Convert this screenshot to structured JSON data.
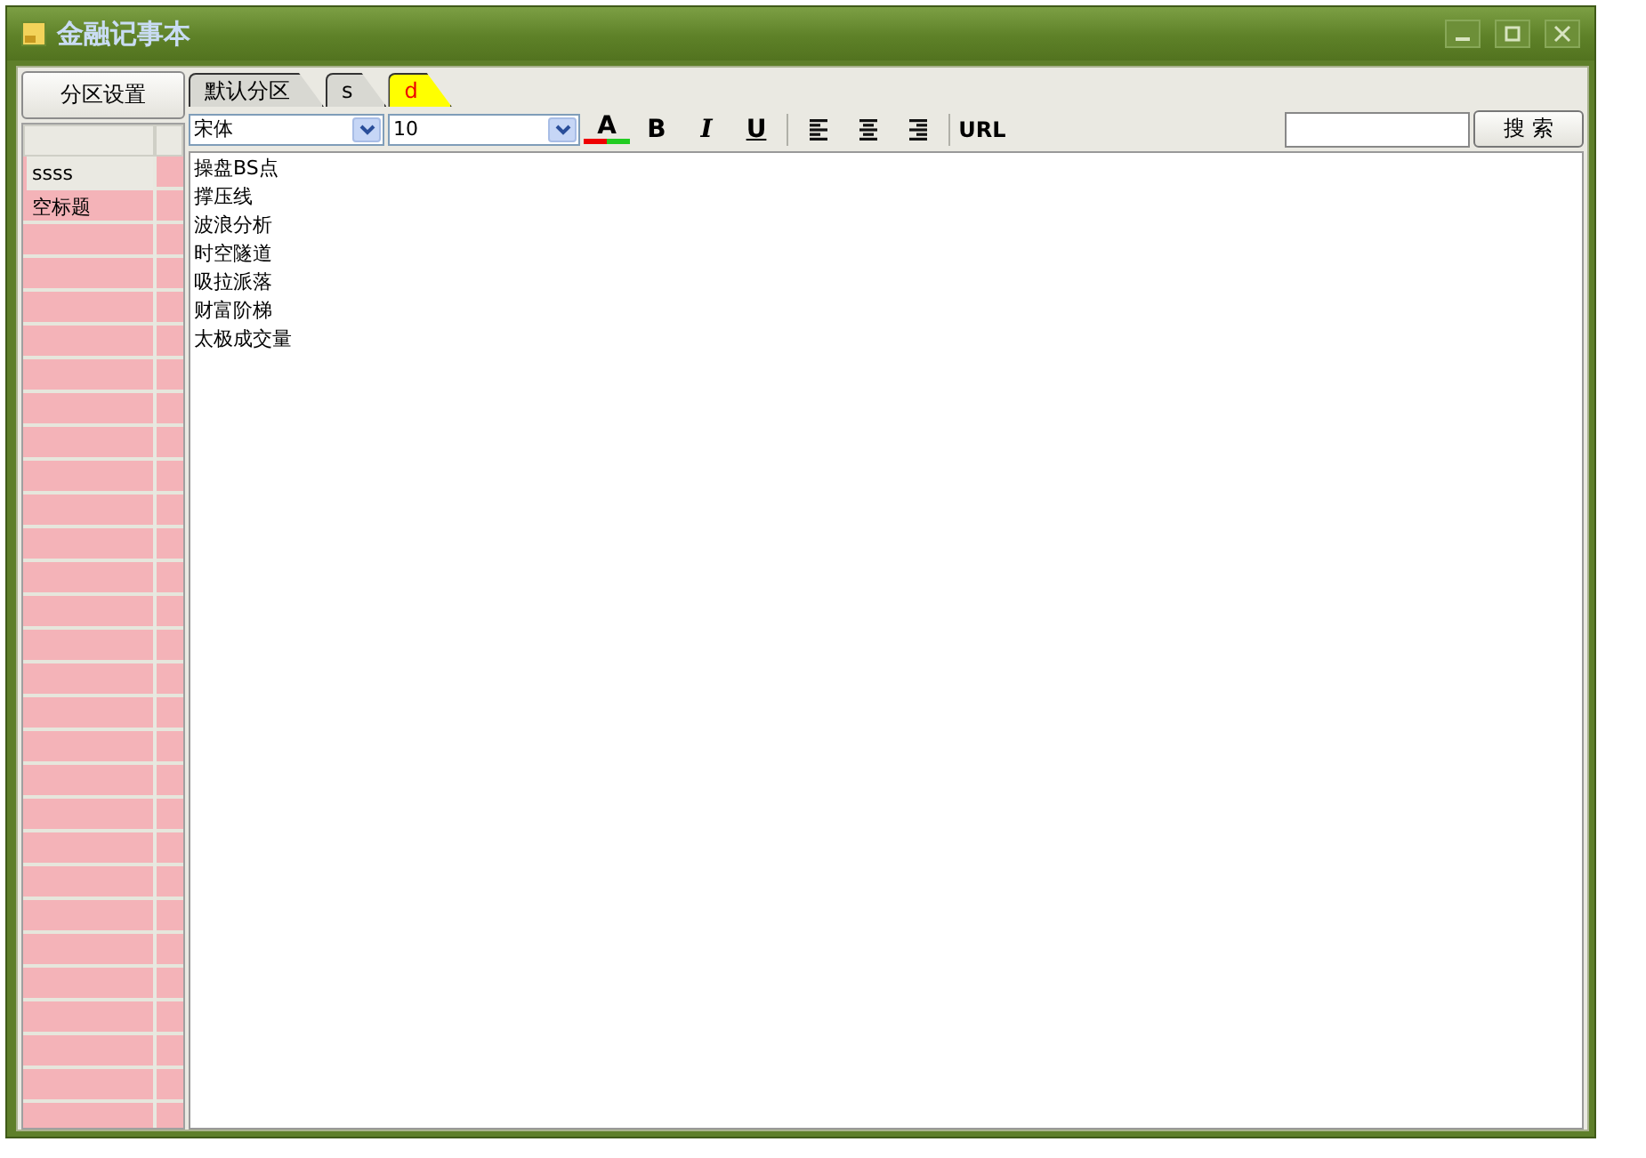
{
  "window": {
    "title": "金融记事本"
  },
  "sidebar": {
    "settings_button": "分区设置",
    "items": [
      {
        "title": "ssss",
        "selected": true
      },
      {
        "title": "空标题",
        "selected": false
      }
    ]
  },
  "tabs": [
    {
      "label": "默认分区",
      "selected": false
    },
    {
      "label": "s",
      "selected": false
    },
    {
      "label": "d",
      "selected": true
    }
  ],
  "toolbar": {
    "font": "宋体",
    "size": "10",
    "buttons": [
      {
        "kind": "color",
        "label": "A"
      },
      {
        "kind": "bold",
        "label": "B"
      },
      {
        "kind": "italic",
        "label": "I"
      },
      {
        "kind": "underline",
        "label": "U"
      },
      {
        "kind": "sep"
      },
      {
        "kind": "align-left"
      },
      {
        "kind": "align-center"
      },
      {
        "kind": "align-right"
      },
      {
        "kind": "sep"
      },
      {
        "kind": "link",
        "label": "URL"
      }
    ],
    "search_button": "搜 索"
  },
  "editor": {
    "lines": [
      "操盘BS点",
      "撑压线",
      "波浪分析",
      "时空隧道",
      "吸拉派落",
      "财富阶梯",
      "太极成交量"
    ]
  }
}
